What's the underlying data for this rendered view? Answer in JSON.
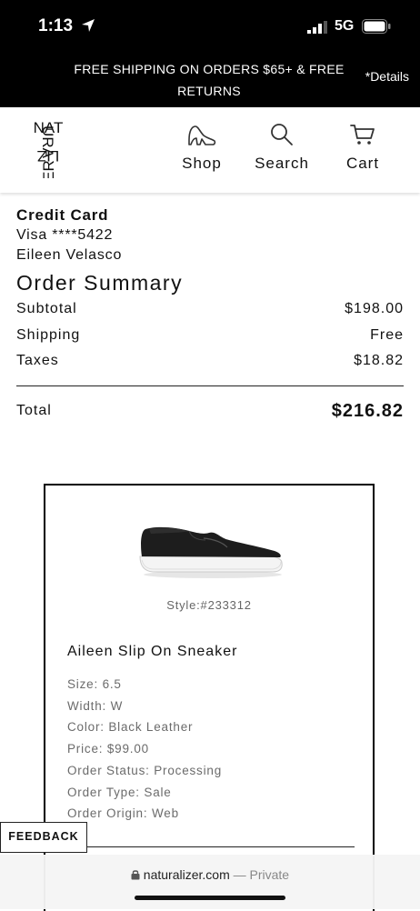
{
  "status_bar": {
    "time": "1:13",
    "network": "5G"
  },
  "promo": {
    "text": "FREE SHIPPING ON ORDERS $65+ & FREE RETURNS",
    "details": "*Details"
  },
  "header": {
    "logo_rows": [
      "NAT",
      "URA",
      "LIZ",
      "ER"
    ],
    "nav": [
      {
        "label": "Shop",
        "icon": "shoe-icon"
      },
      {
        "label": "Search",
        "icon": "search-icon"
      },
      {
        "label": "Cart",
        "icon": "cart-icon"
      }
    ]
  },
  "payment": {
    "title": "Credit Card",
    "card": "Visa ****5422",
    "name": "Eileen Velasco"
  },
  "summary": {
    "title": "Order Summary",
    "rows": [
      {
        "label": "Subtotal",
        "value": "$198.00"
      },
      {
        "label": "Shipping",
        "value": "Free"
      },
      {
        "label": "Taxes",
        "value": "$18.82"
      }
    ],
    "total_label": "Total",
    "total_value": "$216.82"
  },
  "item": {
    "style": "Style:#233312",
    "name": "Aileen Slip On Sneaker",
    "details": [
      "Size: 6.5",
      "Width: W",
      "Color: Black Leather",
      "Price: $99.00",
      "Order Status: Processing",
      "Order Type: Sale",
      "Order Origin: Web"
    ]
  },
  "feedback": "FEEDBACK",
  "browser": {
    "domain": "naturalizer.com",
    "separator": "—",
    "mode": "Private"
  }
}
